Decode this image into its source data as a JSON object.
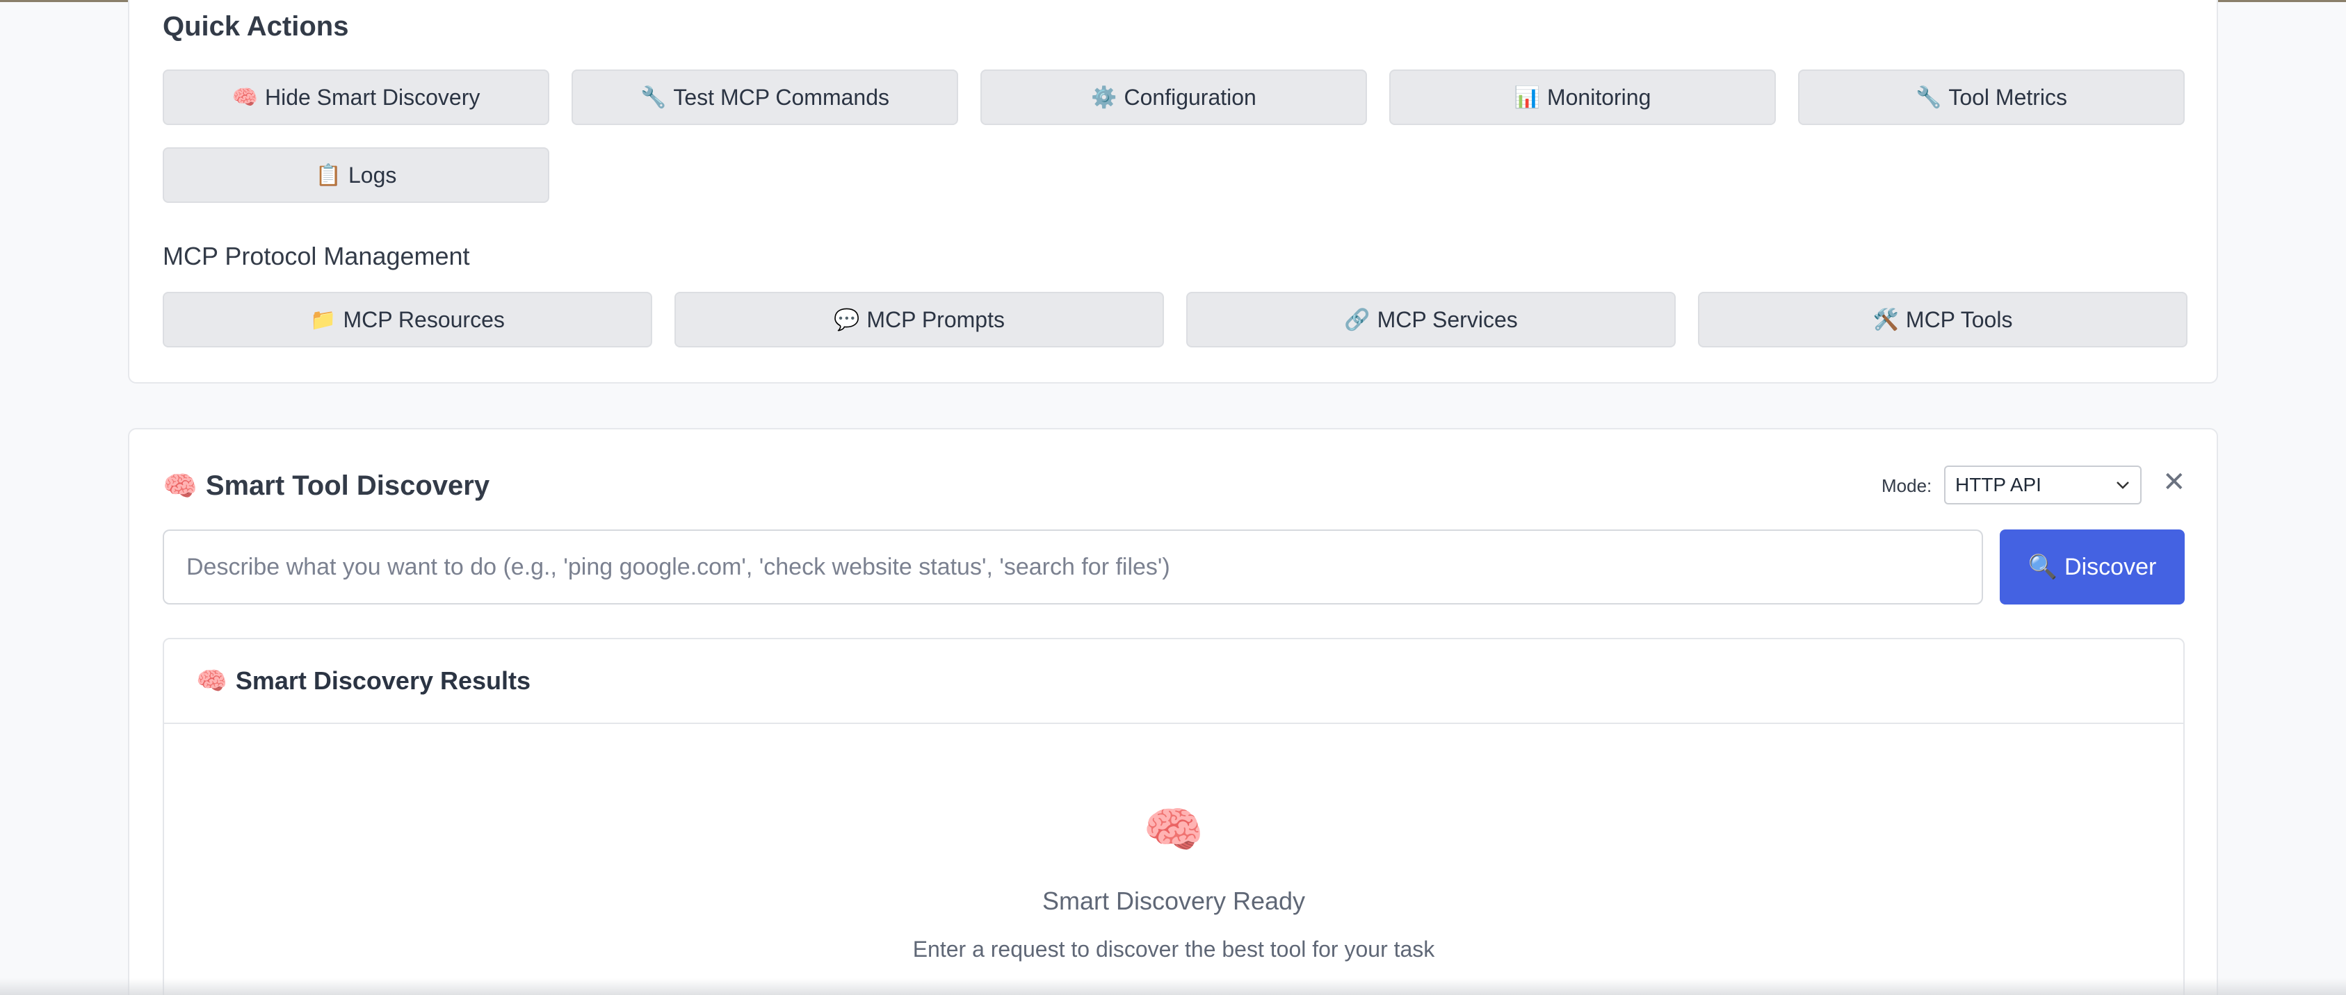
{
  "quick_actions": {
    "title": "Quick Actions",
    "buttons": [
      {
        "icon": "🧠",
        "icon_name": "brain-icon",
        "label": "Hide Smart Discovery"
      },
      {
        "icon": "🔧",
        "icon_name": "wrench-icon",
        "label": "Test MCP Commands"
      },
      {
        "icon": "⚙️",
        "icon_name": "gear-icon",
        "label": "Configuration"
      },
      {
        "icon": "📊",
        "icon_name": "bar-chart-icon",
        "label": "Monitoring"
      },
      {
        "icon": "🔧",
        "icon_name": "wrench-icon",
        "label": "Tool Metrics"
      },
      {
        "icon": "📋",
        "icon_name": "clipboard-icon",
        "label": "Logs"
      }
    ]
  },
  "mcp_management": {
    "title": "MCP Protocol Management",
    "buttons": [
      {
        "icon": "📁",
        "icon_name": "folder-icon",
        "label": "MCP Resources"
      },
      {
        "icon": "💬",
        "icon_name": "speech-bubble-icon",
        "label": "MCP Prompts"
      },
      {
        "icon": "🔗",
        "icon_name": "link-icon",
        "label": "MCP Services"
      },
      {
        "icon": "🛠️",
        "icon_name": "tools-icon",
        "label": "MCP Tools"
      }
    ]
  },
  "discovery": {
    "icon": "🧠",
    "title": "Smart Tool Discovery",
    "mode_label": "Mode:",
    "mode_value": "HTTP API",
    "close": "✕",
    "placeholder": "Describe what you want to do (e.g., 'ping google.com', 'check website status', 'search for files')",
    "discover_icon": "🔍",
    "discover_label": "Discover",
    "results": {
      "icon": "🧠",
      "title": "Smart Discovery Results",
      "empty_icon": "🧠",
      "empty_title": "Smart Discovery Ready",
      "empty_subtitle": "Enter a request to discover the best tool for your task"
    }
  },
  "colors": {
    "primary": "#4462e2",
    "button_bg": "#e8e9ec",
    "page_bg": "#f8f9fb"
  }
}
